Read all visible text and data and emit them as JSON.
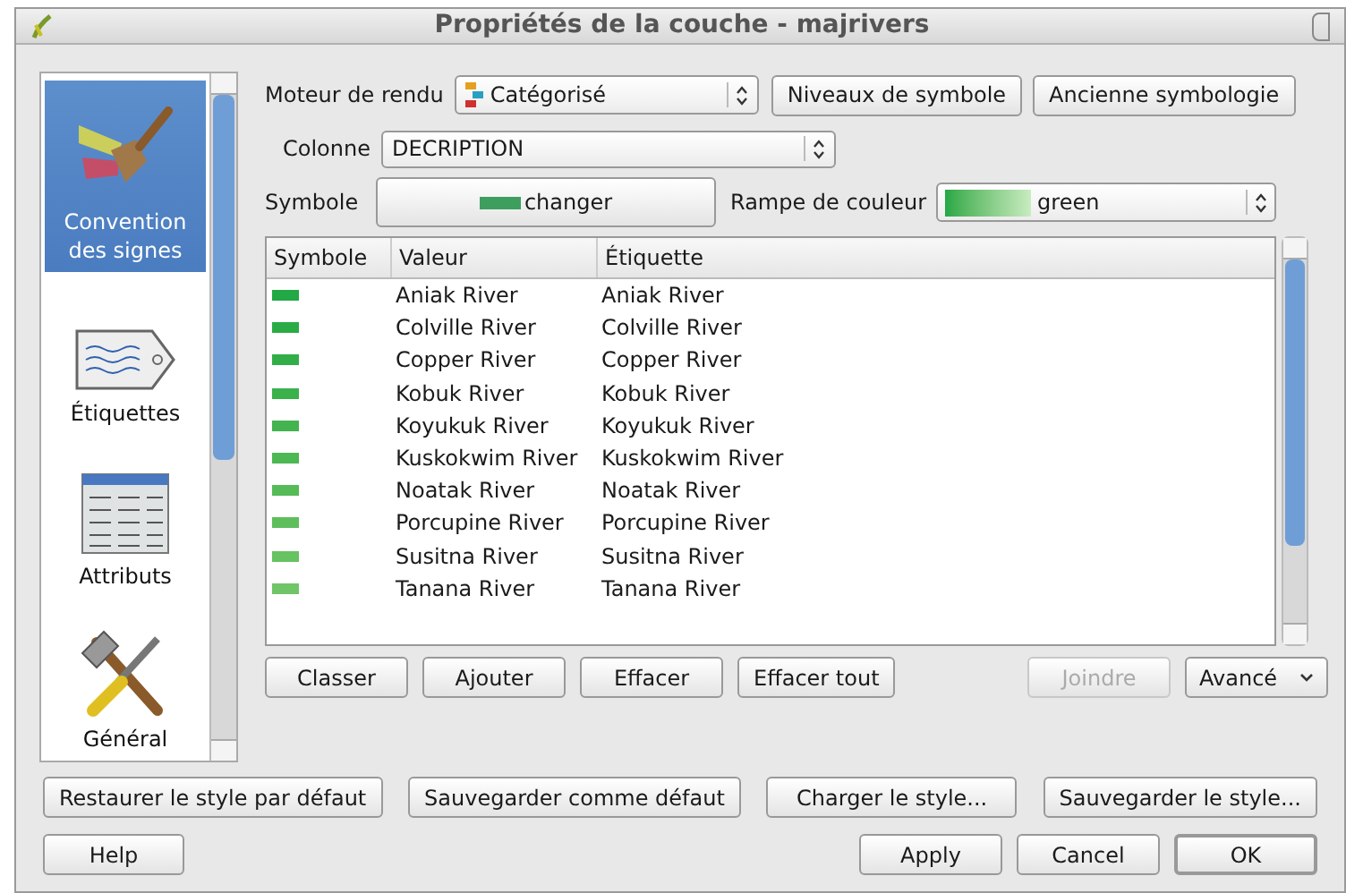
{
  "window": {
    "title": "Propriétés de la couche - majrivers"
  },
  "sidebar": {
    "items": [
      {
        "label": "Convention des signes",
        "kind": "brush",
        "selected": true
      },
      {
        "label": "Étiquettes",
        "kind": "tag",
        "selected": false
      },
      {
        "label": "Attributs",
        "kind": "table",
        "selected": false
      },
      {
        "label": "Général",
        "kind": "tools",
        "selected": false
      }
    ]
  },
  "renderer": {
    "label": "Moteur de rendu",
    "value": "Catégorisé",
    "buttons": [
      "Niveaux de symbole",
      "Ancienne symbologie"
    ]
  },
  "column": {
    "label": "Colonne",
    "value": "DECRIPTION"
  },
  "symbol": {
    "label": "Symbole",
    "button": "changer"
  },
  "color_ramp": {
    "label": "Rampe de couleur",
    "value": "green"
  },
  "table": {
    "columns": [
      "Symbole",
      "Valeur",
      "Étiquette"
    ],
    "rows": [
      {
        "color": "#22a844",
        "value": "Aniak River",
        "label": "Aniak River"
      },
      {
        "color": "#2aab46",
        "value": "Colville River",
        "label": "Colville River"
      },
      {
        "color": "#32ae48",
        "value": "Copper River",
        "label": "Copper River"
      },
      {
        "color": "#3ab14b",
        "value": "Kobuk River",
        "label": "Kobuk River"
      },
      {
        "color": "#43b44f",
        "value": "Koyukuk River",
        "label": "Koyukuk River"
      },
      {
        "color": "#4cb853",
        "value": "Kuskokwim River",
        "label": "Kuskokwim River"
      },
      {
        "color": "#55bb57",
        "value": "Noatak River",
        "label": "Noatak River"
      },
      {
        "color": "#5ebe5c",
        "value": "Porcupine River",
        "label": "Porcupine River"
      },
      {
        "color": "#67c261",
        "value": "Susitna River",
        "label": "Susitna River"
      },
      {
        "color": "#70c566",
        "value": "Tanana River",
        "label": "Tanana River"
      }
    ]
  },
  "table_buttons": [
    {
      "label": "Classer",
      "disabled": false
    },
    {
      "label": "Ajouter",
      "disabled": false
    },
    {
      "label": "Effacer",
      "disabled": false
    },
    {
      "label": "Effacer tout",
      "disabled": false
    },
    {
      "label": "Joindre",
      "disabled": true
    }
  ],
  "advanced": {
    "label": "Avancé"
  },
  "style_buttons": [
    "Restaurer le style par défaut",
    "Sauvegarder comme défaut",
    "Charger le style...",
    "Sauvegarder le style..."
  ],
  "help_button": "Help",
  "dialog_buttons": [
    {
      "label": "Apply",
      "default": false
    },
    {
      "label": "Cancel",
      "default": false
    },
    {
      "label": "OK",
      "default": true
    }
  ]
}
